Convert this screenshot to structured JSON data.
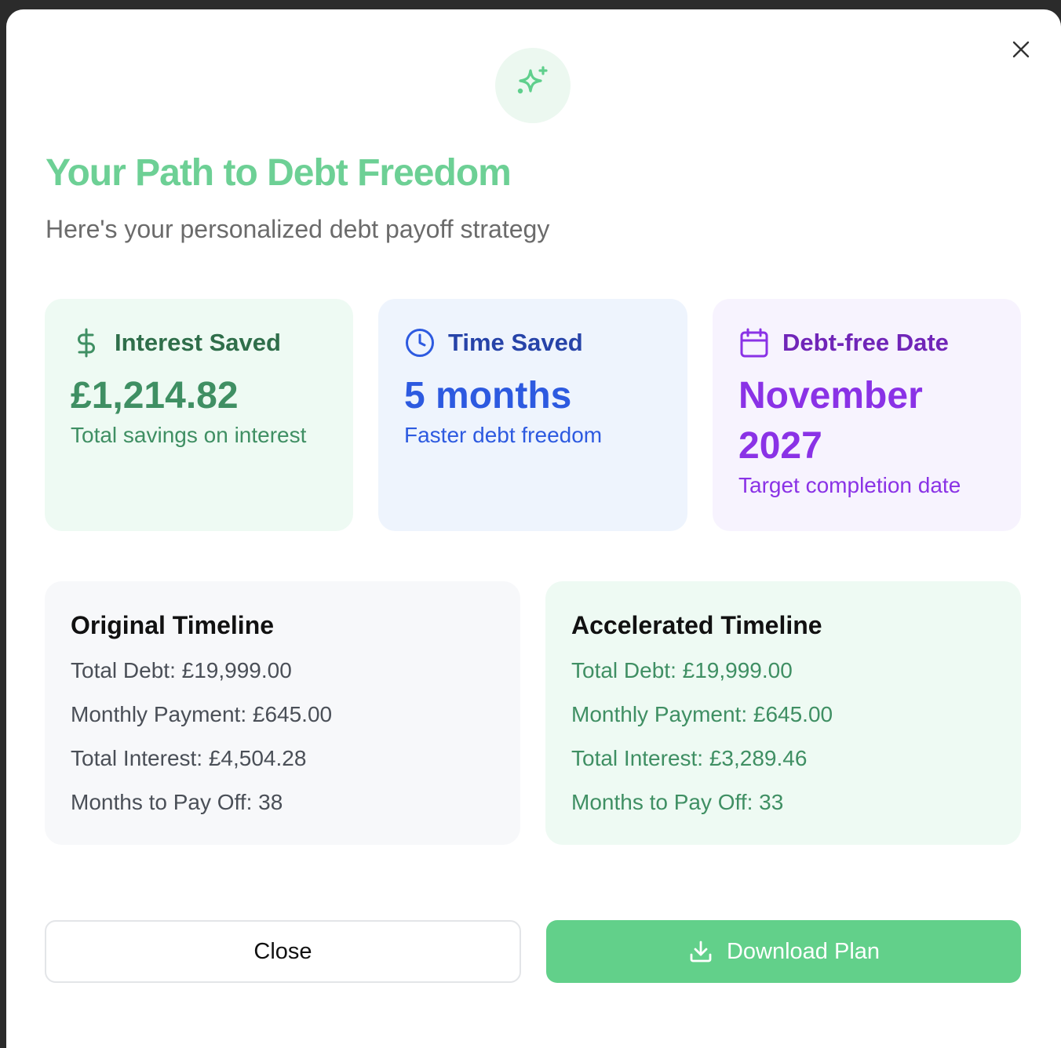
{
  "dialog": {
    "close_icon": "close-icon",
    "hero_icon": "sparkles-icon",
    "title": "Your Path to Debt Freedom",
    "subtitle": "Here's your personalized debt payoff strategy"
  },
  "stats": [
    {
      "icon": "dollar-icon",
      "label": "Interest Saved",
      "value": "£1,214.82",
      "note": "Total savings on interest",
      "color": "#3f8f63"
    },
    {
      "icon": "clock-icon",
      "label": "Time Saved",
      "value": "5 months",
      "note": "Faster debt freedom",
      "color": "#2d5ae0"
    },
    {
      "icon": "calendar-icon",
      "label": "Debt-free Date",
      "value": "November 2027",
      "note": "Target completion date",
      "color": "#8a32e6"
    }
  ],
  "timelines": {
    "original": {
      "title": "Original Timeline",
      "rows": [
        "Total Debt: £19,999.00",
        "Monthly Payment: £645.00",
        "Total Interest: £4,504.28",
        "Months to Pay Off: 38"
      ]
    },
    "accelerated": {
      "title": "Accelerated Timeline",
      "rows": [
        "Total Debt: £19,999.00",
        "Monthly Payment: £645.00",
        "Total Interest: £3,289.46",
        "Months to Pay Off: 33"
      ]
    }
  },
  "actions": {
    "close_label": "Close",
    "download_label": "Download Plan",
    "download_icon": "download-icon"
  },
  "colors": {
    "accent": "#62d08a",
    "title": "#6dd095"
  }
}
